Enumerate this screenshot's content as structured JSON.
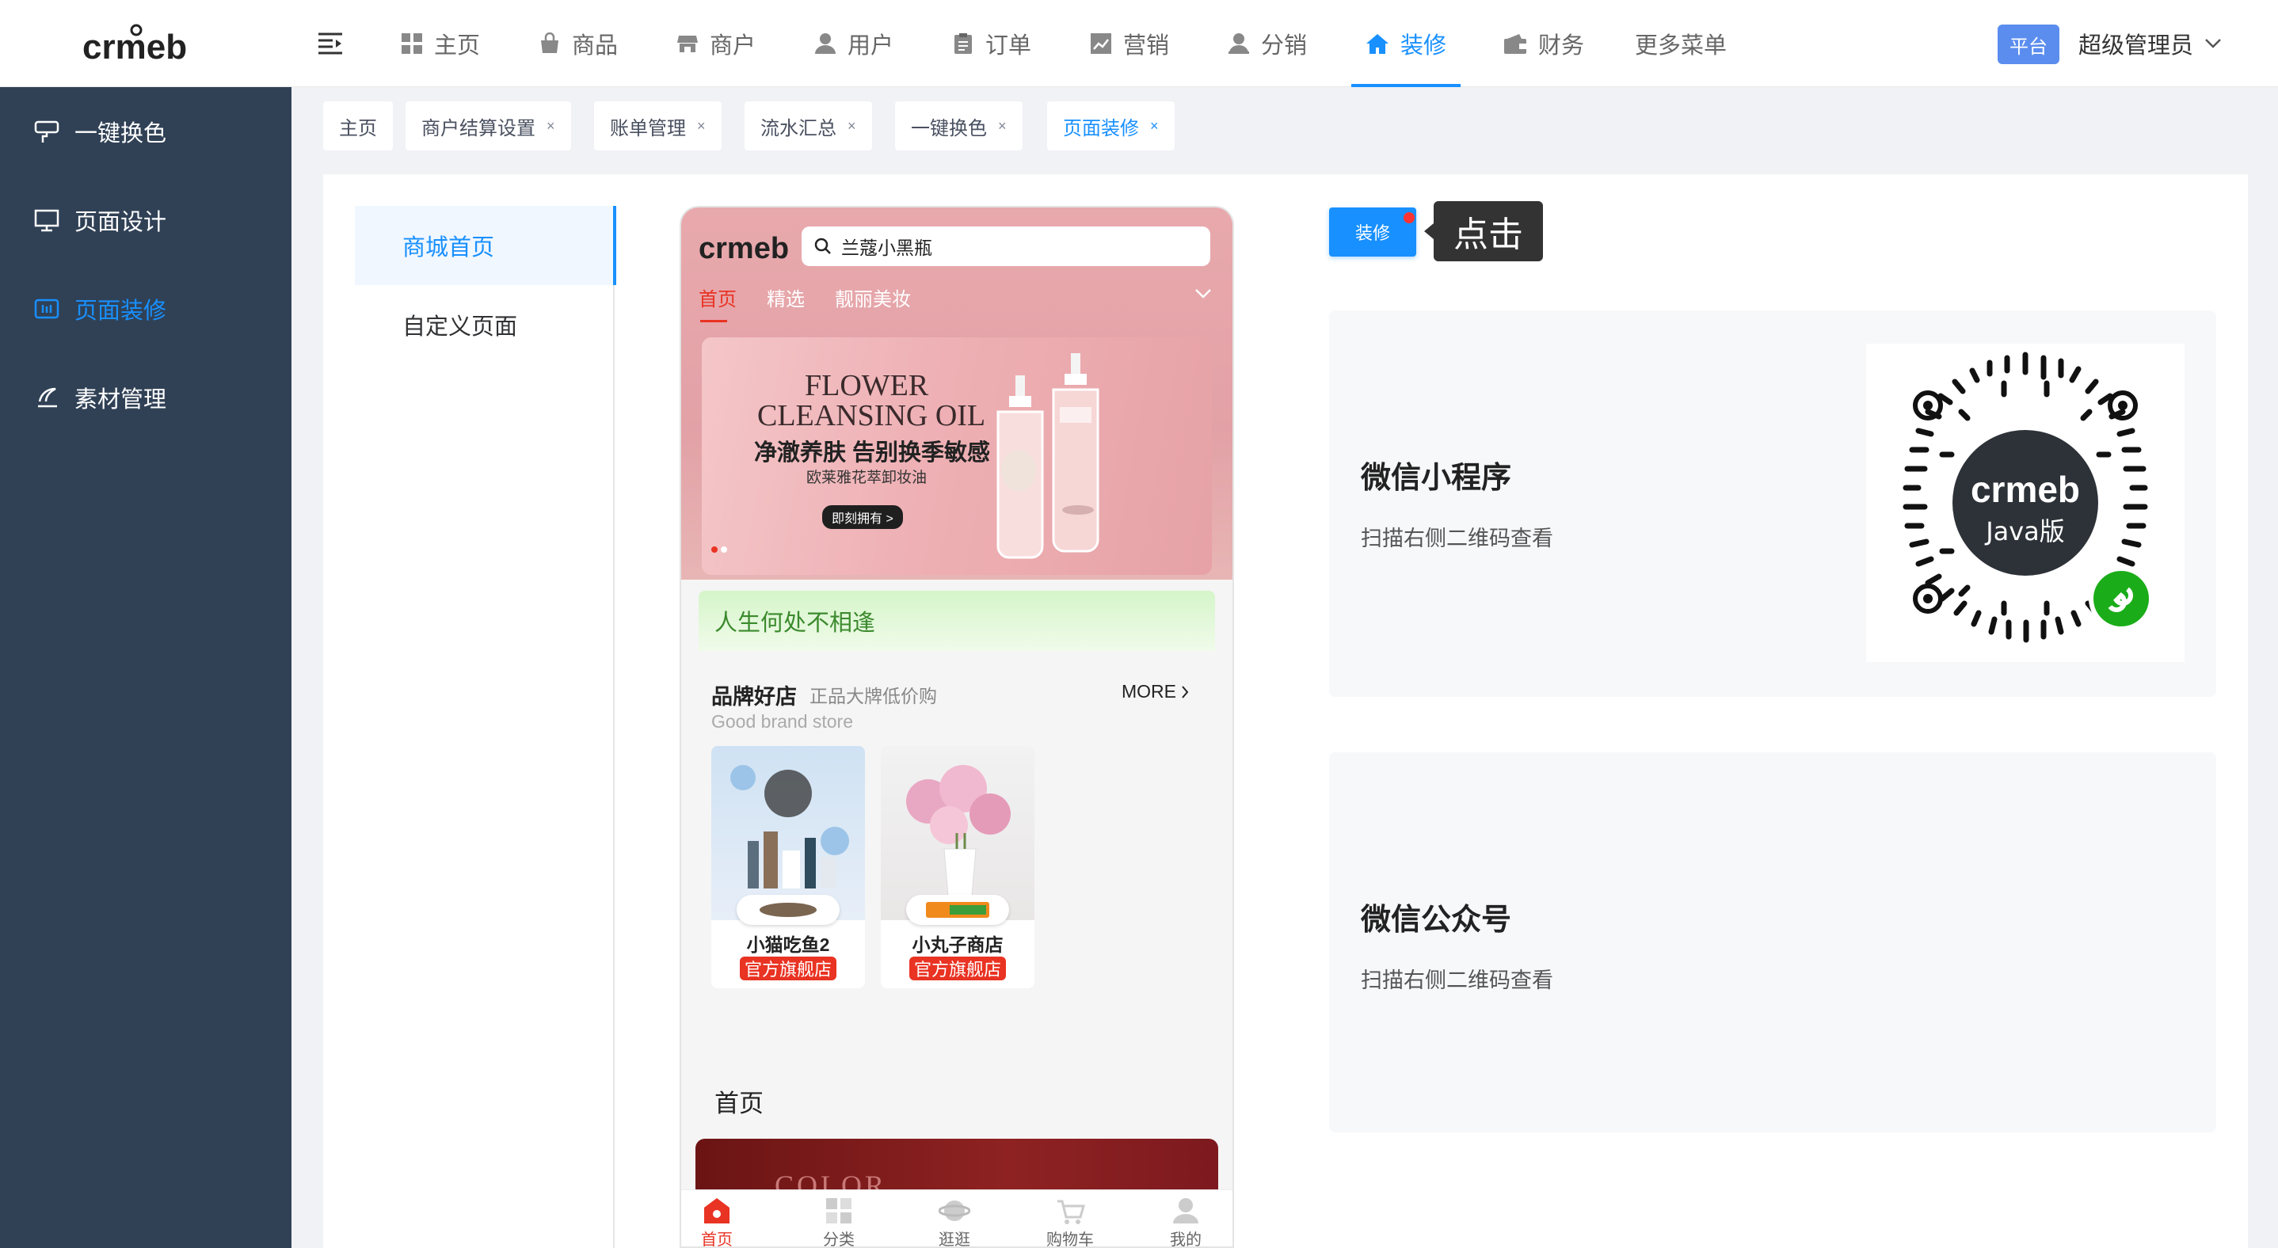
{
  "brand": {
    "logo_text": "crmeb"
  },
  "topnav": {
    "items": [
      {
        "label": "主页",
        "icon": "grid-icon"
      },
      {
        "label": "商品",
        "icon": "bag-icon"
      },
      {
        "label": "商户",
        "icon": "store-icon"
      },
      {
        "label": "用户",
        "icon": "user-icon"
      },
      {
        "label": "订单",
        "icon": "clipboard-icon"
      },
      {
        "label": "营销",
        "icon": "chart-icon"
      },
      {
        "label": "分销",
        "icon": "person-icon"
      },
      {
        "label": "装修",
        "icon": "home-icon",
        "active": true
      },
      {
        "label": "财务",
        "icon": "wallet-icon"
      },
      {
        "label": "更多菜单",
        "icon": ""
      }
    ],
    "platform_badge": "平台",
    "admin_name": "超级管理员"
  },
  "sidebar": {
    "items": [
      {
        "label": "一键换色",
        "icon": "palette-icon"
      },
      {
        "label": "页面设计",
        "icon": "monitor-icon"
      },
      {
        "label": "页面装修",
        "icon": "layout-icon",
        "active": true
      },
      {
        "label": "素材管理",
        "icon": "material-icon"
      }
    ]
  },
  "tags": [
    {
      "label": "主页",
      "closable": false
    },
    {
      "label": "商户结算设置",
      "closable": true
    },
    {
      "label": "账单管理",
      "closable": true
    },
    {
      "label": "流水汇总",
      "closable": true
    },
    {
      "label": "一键换色",
      "closable": true
    },
    {
      "label": "页面装修",
      "closable": true,
      "active": true
    }
  ],
  "close_glyph": "×",
  "page_menu": [
    {
      "label": "商城首页",
      "active": true
    },
    {
      "label": "自定义页面"
    }
  ],
  "phone": {
    "logo_text": "crmeb",
    "search_value": "兰蔻小黑瓶",
    "tabs": [
      "首页",
      "精选",
      "靓丽美妆"
    ],
    "banner": {
      "line1": "FLOWER",
      "line2": "CLEANSING OIL",
      "headline": "净澈养肤 告别换季敏感",
      "subline": "欧莱雅花萃卸妆油",
      "cta": "即刻拥有 >"
    },
    "notice": "人生何处不相逢",
    "brand_section": {
      "title": "品牌好店",
      "subtitle": "正品大牌低价购",
      "english": "Good brand store",
      "more": "MORE"
    },
    "stores": [
      {
        "name": "小猫吃鱼2",
        "badge": "官方旗舰店"
      },
      {
        "name": "小丸子商店",
        "badge": "官方旗舰店"
      }
    ],
    "home_label": "首页",
    "red_banner_text": "COLOR",
    "tabbar": [
      "首页",
      "分类",
      "逛逛",
      "购物车",
      "我的"
    ]
  },
  "right": {
    "decorate_button": "装修",
    "tooltip": "点击",
    "panels": [
      {
        "title": "微信小程序",
        "desc": "扫描右侧二维码查看"
      },
      {
        "title": "微信公众号",
        "desc": "扫描右侧二维码查看"
      }
    ],
    "qr_center_logo": "crmeb",
    "qr_center_sub": "Java版"
  },
  "colors": {
    "accent": "#1890ff",
    "sidebar": "#304156",
    "brand_red": "#e93323"
  }
}
